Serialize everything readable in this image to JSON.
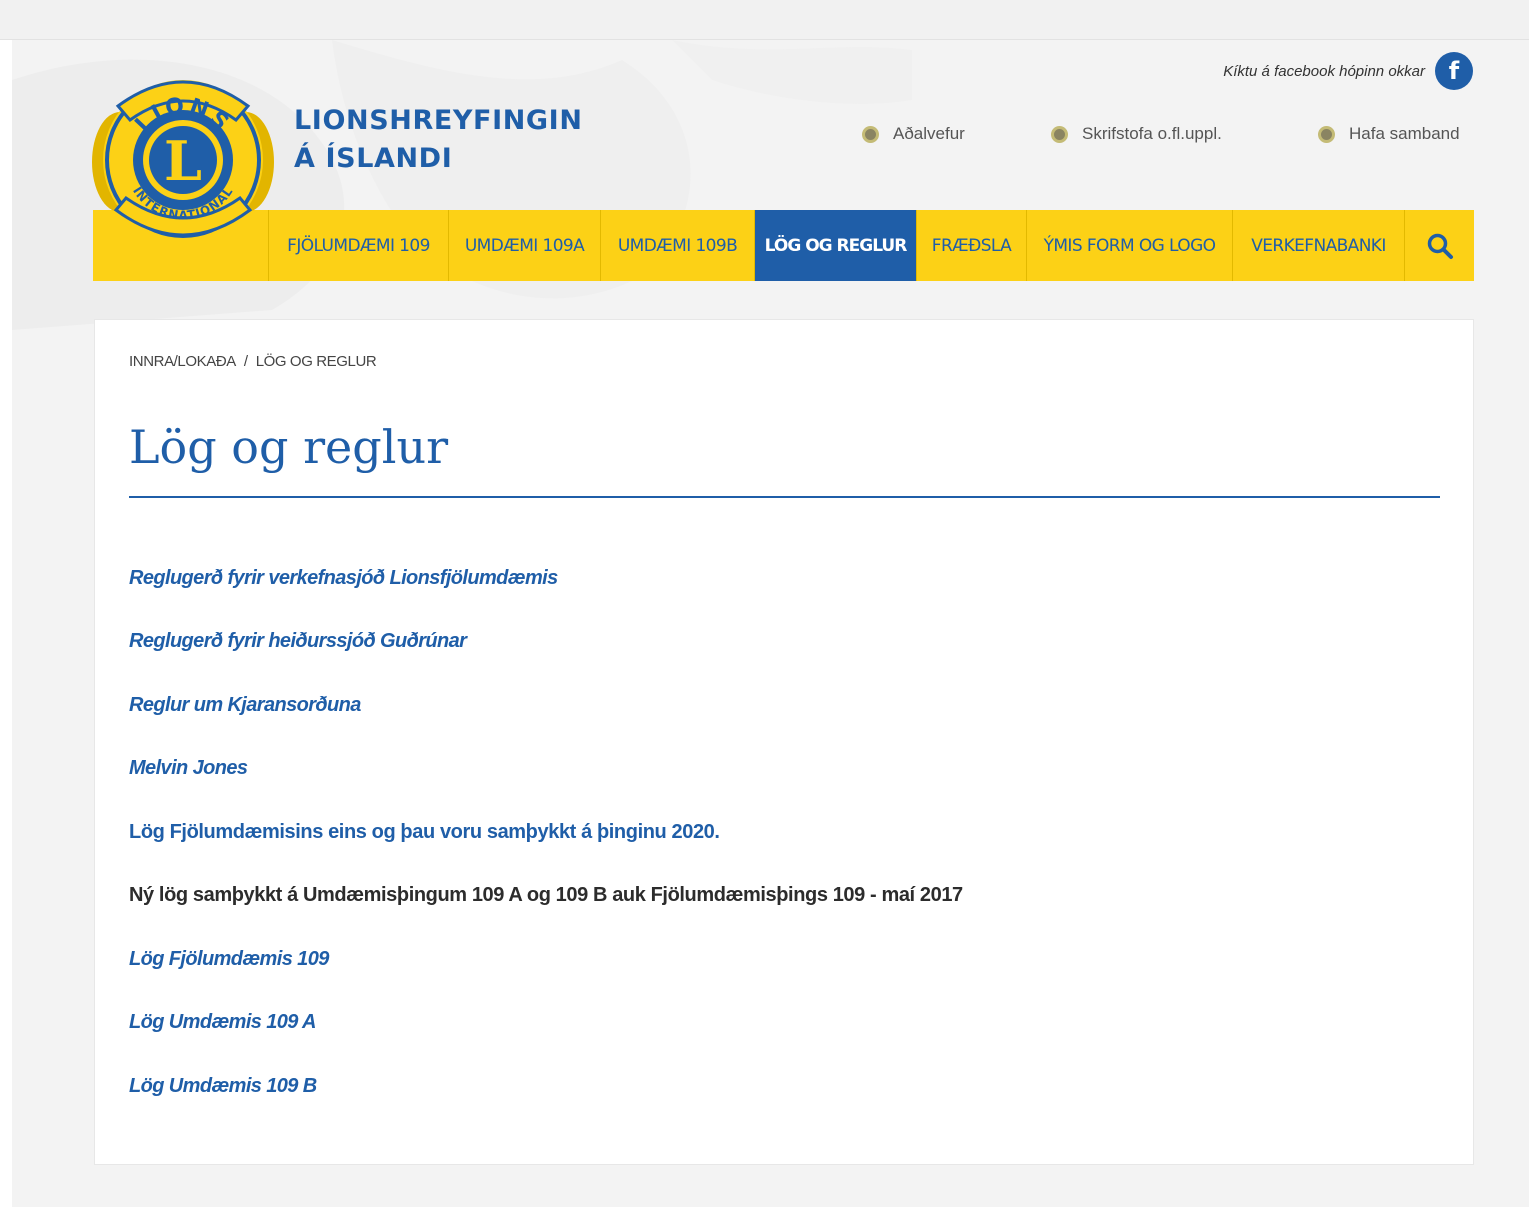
{
  "header": {
    "site_title_line1": "LIONSHREYFINGIN",
    "site_title_line2": "Á ÍSLANDI",
    "facebook_text": "Kíktu á facebook hópinn okkar",
    "facebook_icon": "facebook-icon",
    "top_links": [
      {
        "label": "Aðalvefur"
      },
      {
        "label": "Skrifstofa o.fl.uppl."
      },
      {
        "label": "Hafa samband"
      }
    ]
  },
  "nav": {
    "items": [
      {
        "label": "FJÖLUMDÆMI 109"
      },
      {
        "label": "UMDÆMI 109A"
      },
      {
        "label": "UMDÆMI 109B"
      },
      {
        "label": "LÖG OG REGLUR",
        "active": true
      },
      {
        "label": "FRÆÐSLA"
      },
      {
        "label": "ÝMIS FORM OG LOGO"
      },
      {
        "label": "VERKEFNABANKI"
      }
    ],
    "search_icon": "search-icon"
  },
  "breadcrumb": {
    "parent": "INNRA/LOKAÐA",
    "separator": "/",
    "current": "LÖG OG REGLUR"
  },
  "page": {
    "title": "Lög og reglur"
  },
  "documents": [
    {
      "label": "Reglugerð fyrir verkefnasjóð Lionsfjölumdæmis",
      "style": "italic"
    },
    {
      "label": "Reglugerð fyrir heiðurssjóð Guðrúnar",
      "style": "italic"
    },
    {
      "label": "Reglur um Kjaransorðuna",
      "style": "italic"
    },
    {
      "label": "Melvin Jones",
      "style": "italic"
    },
    {
      "label": "Lög Fjölumdæmisins eins og þau voru samþykkt á þinginu 2020.",
      "style": "bold"
    },
    {
      "label": "Ný lög samþykkt á Umdæmisþingum 109 A og 109 B auk Fjölumdæmisþings 109 - maí 2017",
      "style": "dark"
    },
    {
      "label": "Lög Fjölumdæmis 109",
      "style": "italic"
    },
    {
      "label": "Lög Umdæmis 109 A",
      "style": "italic"
    },
    {
      "label": "Lög Umdæmis 109 B",
      "style": "italic"
    }
  ],
  "colors": {
    "brand_blue": "#1f5ea8",
    "brand_yellow": "#fcd116",
    "page_bg": "#f3f3f3"
  },
  "logo": {
    "top_text": "LIONS",
    "center_letter": "L",
    "bottom_text": "INTERNATIONAL"
  }
}
